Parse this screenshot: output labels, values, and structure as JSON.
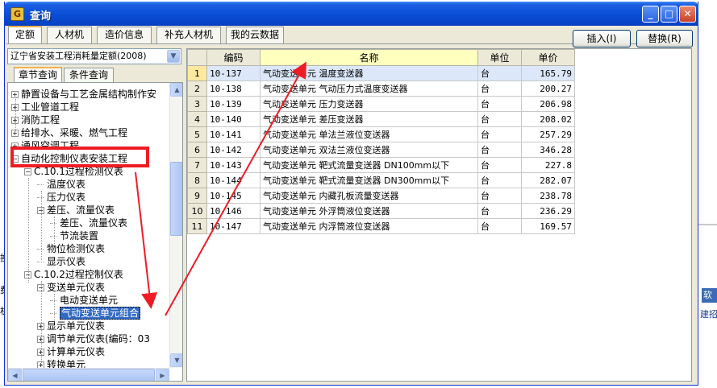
{
  "window": {
    "title": "查询"
  },
  "title_buttons": {
    "minimize": "_",
    "maximize": "□",
    "close": "✕"
  },
  "tabs": [
    "定额",
    "人材机",
    "造价信息",
    "补充人材机",
    "我的云数据"
  ],
  "buttons": {
    "insert": "插入(I)",
    "replace": "替换(R)"
  },
  "library_select": {
    "value": "辽宁省安装工程消耗量定额(2008)"
  },
  "left_tabs": [
    "章节查询",
    "条件查询"
  ],
  "tree": [
    {
      "label": "静置设备与工艺金属结构制作安",
      "level": 0,
      "exp": "+"
    },
    {
      "label": "工业管道工程",
      "level": 0,
      "exp": "+"
    },
    {
      "label": "消防工程",
      "level": 0,
      "exp": "+"
    },
    {
      "label": "给排水、采暖、燃气工程",
      "level": 0,
      "exp": "+"
    },
    {
      "label": "通风空调工程",
      "level": 0,
      "exp": "+"
    },
    {
      "label": "自动化控制仪表安装工程",
      "level": 0,
      "exp": "-"
    },
    {
      "label": "C.10.1过程检测仪表",
      "level": 1,
      "exp": "-"
    },
    {
      "label": "温度仪表",
      "level": 2,
      "exp": ""
    },
    {
      "label": "压力仪表",
      "level": 2,
      "exp": ""
    },
    {
      "label": "差压、流量仪表",
      "level": 2,
      "exp": "-"
    },
    {
      "label": "差压、流量仪表",
      "level": 3,
      "exp": ""
    },
    {
      "label": "节流装置",
      "level": 3,
      "exp": ""
    },
    {
      "label": "物位检测仪表",
      "level": 2,
      "exp": ""
    },
    {
      "label": "显示仪表",
      "level": 2,
      "exp": ""
    },
    {
      "label": "C.10.2过程控制仪表",
      "level": 1,
      "exp": "-"
    },
    {
      "label": "变送单元仪表",
      "level": 2,
      "exp": "-"
    },
    {
      "label": "电动变送单元",
      "level": 3,
      "exp": ""
    },
    {
      "label": "气动变送单元组合",
      "level": 3,
      "exp": "",
      "selected": true
    },
    {
      "label": "显示单元仪表",
      "level": 2,
      "exp": "+"
    },
    {
      "label": "调节单元仪表(编码：03",
      "level": 2,
      "exp": "+"
    },
    {
      "label": "计算单元仪表",
      "level": 2,
      "exp": "+"
    },
    {
      "label": "转换单元",
      "level": 2,
      "exp": "+"
    }
  ],
  "grid": {
    "headers": [
      "编码",
      "名称",
      "单位",
      "单价"
    ],
    "rows": [
      {
        "n": "1",
        "code": "10-137",
        "name": "气动变送单元 温度变送器",
        "unit": "台",
        "price": "165.79"
      },
      {
        "n": "2",
        "code": "10-138",
        "name": "气动变送单元 气动压力式温度变送器",
        "unit": "台",
        "price": "200.27"
      },
      {
        "n": "3",
        "code": "10-139",
        "name": "气动变送单元 压力变送器",
        "unit": "台",
        "price": "206.98"
      },
      {
        "n": "4",
        "code": "10-140",
        "name": "气动变送单元 差压变送器",
        "unit": "台",
        "price": "208.02"
      },
      {
        "n": "5",
        "code": "10-141",
        "name": "气动变送单元 单法兰液位变送器",
        "unit": "台",
        "price": "257.29"
      },
      {
        "n": "6",
        "code": "10-142",
        "name": "气动变送单元 双法兰液位变送器",
        "unit": "台",
        "price": "346.28"
      },
      {
        "n": "7",
        "code": "10-143",
        "name": "气动变送单元 靶式流量变送器 DN100mm以下",
        "unit": "台",
        "price": "227.8"
      },
      {
        "n": "8",
        "code": "10-144",
        "name": "气动变送单元 靶式流量变送器 DN300mm以下",
        "unit": "台",
        "price": "282.07"
      },
      {
        "n": "9",
        "code": "10-145",
        "name": "气动变送单元 内藏孔板流量变送器",
        "unit": "台",
        "price": "238.78"
      },
      {
        "n": "10",
        "code": "10-146",
        "name": "气动变送单元 外浮筒液位变送器",
        "unit": "台",
        "price": "236.29"
      },
      {
        "n": "11",
        "code": "10-147",
        "name": "气动变送单元 内浮筒液位变送器",
        "unit": "台",
        "price": "169.57"
      }
    ]
  },
  "background": {
    "left_1": "换",
    "left_2": "费合",
    "left_3": "机",
    "right_1": "软件",
    "right_2": "建招"
  },
  "colors": {
    "annotation": "#ee1c24",
    "selection": "#316ac5",
    "titlebar": "#0a4fd6"
  }
}
